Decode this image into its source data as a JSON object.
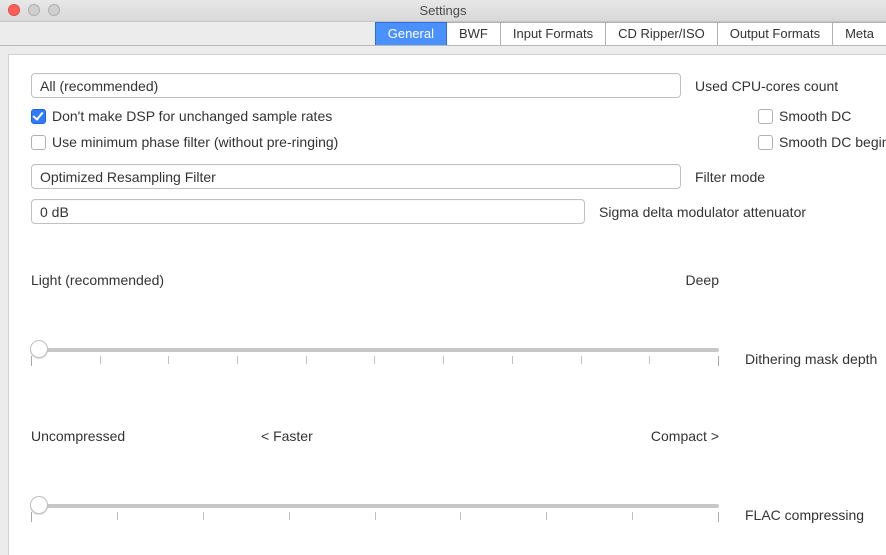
{
  "window": {
    "title": "Settings"
  },
  "tabs": [
    {
      "label": "General",
      "active": true
    },
    {
      "label": "BWF",
      "active": false
    },
    {
      "label": "Input Formats",
      "active": false
    },
    {
      "label": "CD Ripper/ISO",
      "active": false
    },
    {
      "label": "Output Formats",
      "active": false
    },
    {
      "label": "Meta",
      "active": false
    }
  ],
  "cpu_cores": {
    "value": "All (recommended)",
    "label": "Used CPU-cores count"
  },
  "dsp_unchanged": {
    "checked": true,
    "label": "Don't make DSP for unchanged sample rates"
  },
  "smooth_dc": {
    "checked": false,
    "label": "Smooth DC"
  },
  "min_phase": {
    "checked": false,
    "label": "Use minimum phase filter (without pre-ringing)"
  },
  "smooth_dc_begin": {
    "checked": false,
    "label": "Smooth DC begin fir"
  },
  "filter_mode": {
    "value": "Optimized Resampling Filter",
    "label": "Filter mode"
  },
  "sigma_delta": {
    "value": "0 dB",
    "label": "Sigma delta modulator attenuator"
  },
  "dither_slider": {
    "left_label": "Light (recommended)",
    "right_label": "Deep",
    "caption": "Dithering mask depth",
    "value": 0,
    "ticks": 11
  },
  "flac_slider": {
    "left_label": "Uncompressed",
    "mid_label": "< Faster",
    "right_label": "Compact >",
    "caption": "FLAC compressing",
    "value": 0,
    "ticks": 9
  }
}
